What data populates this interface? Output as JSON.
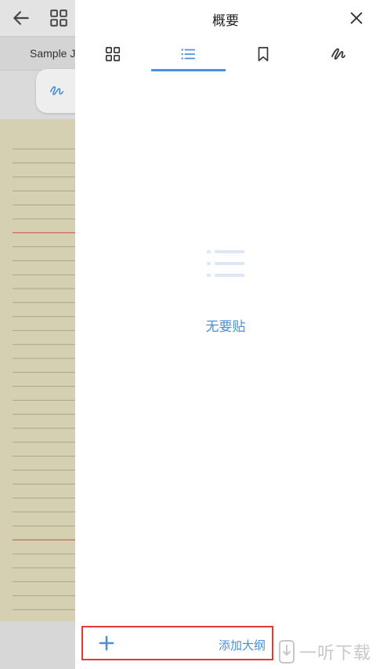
{
  "background_app": {
    "tab_label": "Sample J"
  },
  "panel": {
    "title": "概要",
    "tabs": [
      {
        "icon": "thumbnails-grid-icon"
      },
      {
        "icon": "outline-list-icon",
        "active": true
      },
      {
        "icon": "bookmark-icon"
      },
      {
        "icon": "annotation-pen-icon"
      }
    ],
    "empty_state_text": "无要贴",
    "add_button_label": "添加大纲"
  },
  "watermark": {
    "text": "一听下载"
  },
  "colors": {
    "accent": "#4a90e2",
    "highlight_border": "#e53935",
    "paper": "#d6d0b2"
  }
}
